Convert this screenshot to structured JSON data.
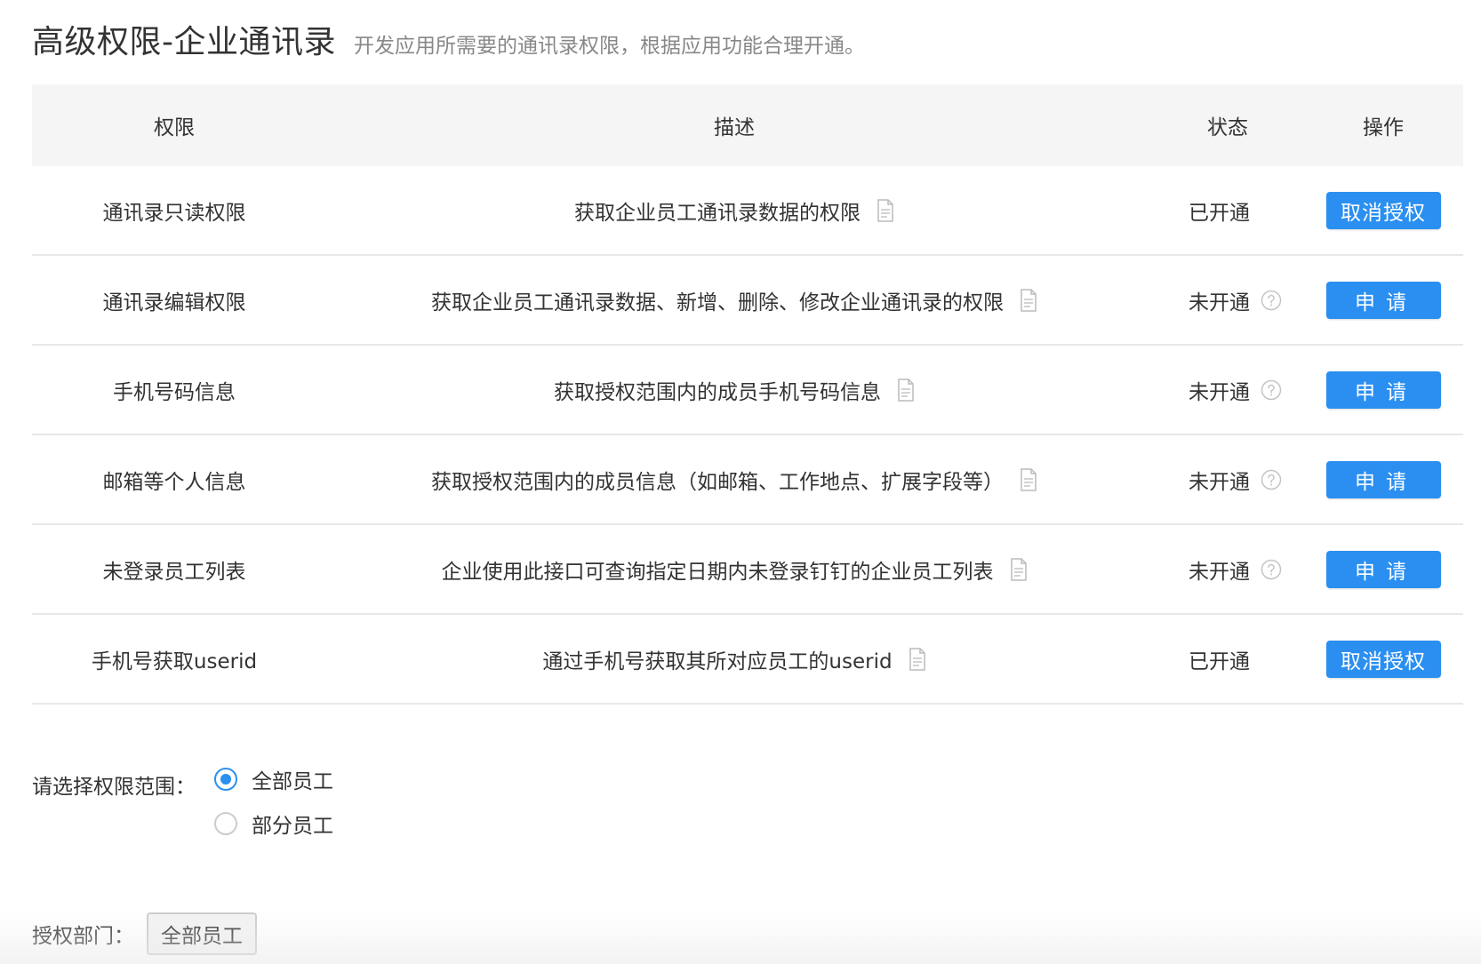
{
  "header": {
    "title": "高级权限-企业通讯录",
    "subtitle": "开发应用所需要的通讯录权限，根据应用功能合理开通。"
  },
  "table": {
    "columns": [
      "权限",
      "描述",
      "状态",
      "操作"
    ],
    "rows": [
      {
        "name": "通讯录只读权限",
        "desc": "获取企业员工通讯录数据的权限",
        "status": "已开通",
        "help": false,
        "action": "取消授权"
      },
      {
        "name": "通讯录编辑权限",
        "desc": "获取企业员工通讯录数据、新增、删除、修改企业通讯录的权限",
        "status": "未开通",
        "help": true,
        "action": "申请"
      },
      {
        "name": "手机号码信息",
        "desc": "获取授权范围内的成员手机号码信息",
        "status": "未开通",
        "help": true,
        "action": "申请"
      },
      {
        "name": "邮箱等个人信息",
        "desc": "获取授权范围内的成员信息（如邮箱、工作地点、扩展字段等）",
        "status": "未开通",
        "help": true,
        "action": "申请"
      },
      {
        "name": "未登录员工列表",
        "desc": "企业使用此接口可查询指定日期内未登录钉钉的企业员工列表",
        "status": "未开通",
        "help": true,
        "action": "申请"
      },
      {
        "name": "手机号获取userid",
        "desc": "通过手机号获取其所对应员工的userid",
        "status": "已开通",
        "help": false,
        "action": "取消授权"
      }
    ]
  },
  "scope": {
    "label": "请选择权限范围：",
    "options": [
      {
        "label": "全部员工",
        "checked": true
      },
      {
        "label": "部分员工",
        "checked": false
      }
    ]
  },
  "dept": {
    "label": "授权部门：",
    "tag": "全部员工"
  },
  "colors": {
    "primary": "#2a8ff0",
    "header_bg": "#f5f5f5",
    "border": "#e8e8e8"
  },
  "icons": {
    "doc": "document-icon",
    "help": "question-circle-icon"
  }
}
